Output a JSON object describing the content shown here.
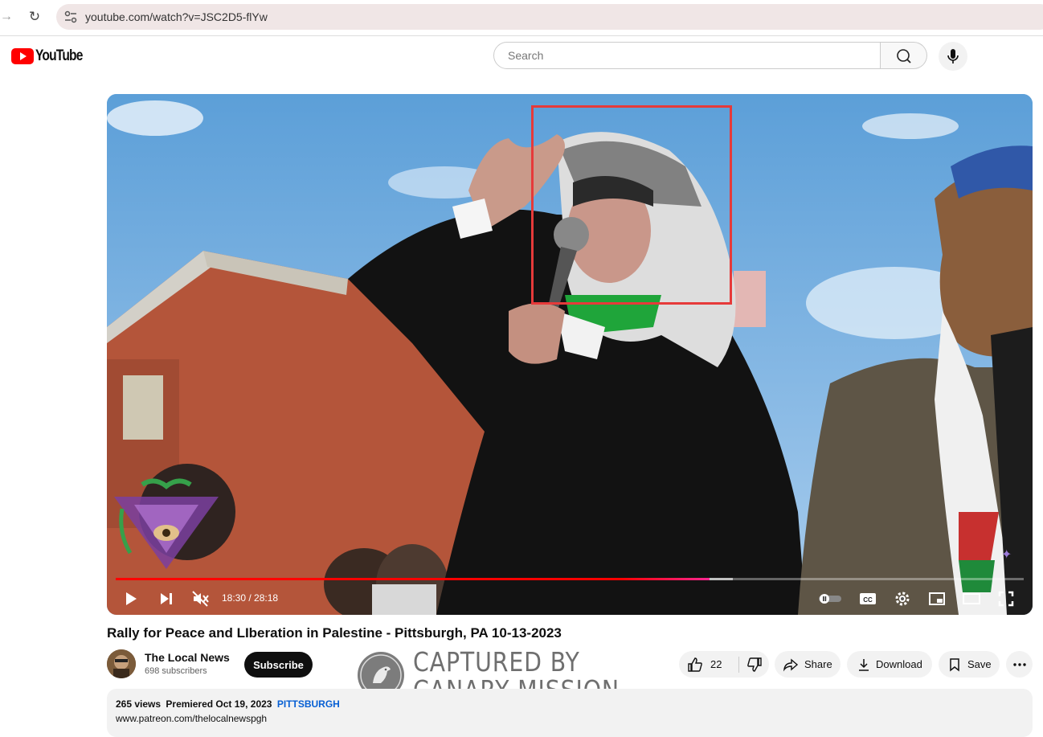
{
  "browser": {
    "url": "youtube.com/watch?v=JSC2D5-flYw",
    "forward_icon": "arrow-right-icon",
    "reload_icon": "reload-icon"
  },
  "header": {
    "logo_text": "YouTube",
    "search_placeholder": "Search",
    "search_icon": "search-icon",
    "mic_icon": "mic-icon"
  },
  "player": {
    "time_display": "18:30 / 28:18",
    "progress_fraction": 0.654,
    "buffered_fraction": 0.68,
    "muted": true
  },
  "video": {
    "title": "Rally for Peace and LIberation in Palestine - Pittsburgh, PA 10-13-2023",
    "channel_name": "The Local News",
    "subscribers": "698 subscribers",
    "subscribe_label": "Subscribe",
    "like_count": "22",
    "share_label": "Share",
    "download_label": "Download",
    "save_label": "Save"
  },
  "description": {
    "views": "265 views",
    "premiered": "Premiered Oct 19, 2023",
    "tag": "PITTSBURGH",
    "link": "www.patreon.com/thelocalnewspgh"
  },
  "watermark": {
    "line1": "CAPTURED BY",
    "line2": "CANARY MISSION"
  },
  "colors": {
    "brand_red": "#ff0000",
    "highlight_box": "#e63a3a",
    "link_blue": "#065fd4"
  }
}
